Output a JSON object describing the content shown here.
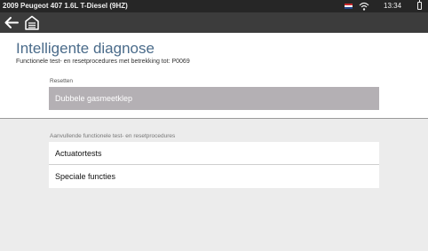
{
  "status_bar": {
    "vehicle": "2009 Peugeot 407 1.6L T-Diesel (9HZ)",
    "time": "13:34"
  },
  "toolbar": {
    "back_icon": "back-arrow-icon",
    "home_icon": "home-garage-icon"
  },
  "page": {
    "title": "Intelligente diagnose",
    "subtitle": "Functionele test- en resetprocedures met betrekking tot:  P0069"
  },
  "reset_section": {
    "label": "Resetten",
    "items": [
      {
        "label": "Dubbele gasmeetklep"
      }
    ]
  },
  "additional_section": {
    "label": "Aanvullende functionele test- en resetprocedures",
    "items": [
      {
        "label": "Actuatortests"
      },
      {
        "label": "Speciale functies"
      }
    ]
  },
  "colors": {
    "title": "#4a6b8a",
    "selected_item": "#b4b0b4",
    "status_bar": "#262626",
    "toolbar": "#3c3c3c"
  }
}
